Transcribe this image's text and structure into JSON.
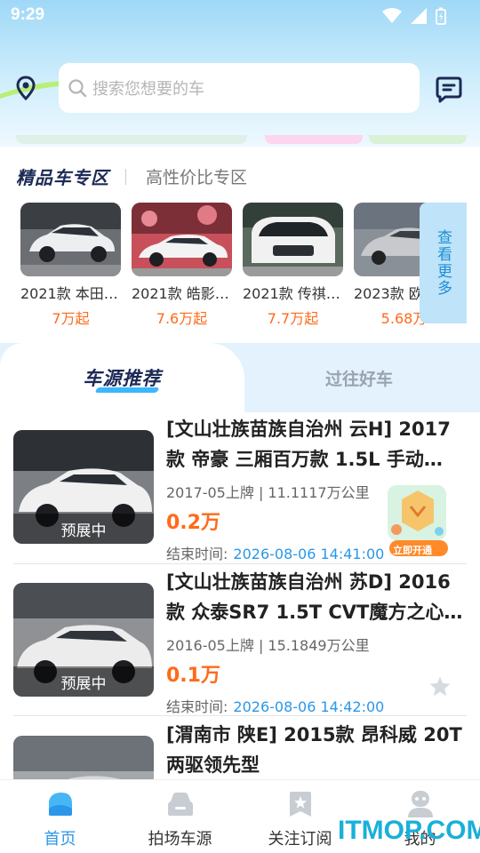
{
  "status_bar": {
    "time": "9:29"
  },
  "search": {
    "placeholder": "搜索您想要的车"
  },
  "zones": {
    "active": "精品车专区",
    "inactive": "高性价比专区"
  },
  "premium_cars": [
    {
      "name": "2021款 本田…",
      "price": "7万起"
    },
    {
      "name": "2021款 皓影…",
      "price": "7.6万起"
    },
    {
      "name": "2021款 传祺…",
      "price": "7.7万起"
    },
    {
      "name": "2023款 欧…",
      "price": "5.68万"
    }
  ],
  "see_more": "查看更多",
  "rec_tabs": {
    "active": "车源推荐",
    "inactive": "过往好车"
  },
  "listings": [
    {
      "title": "[文山壮族苗族自治州 云H] 2017款 帝豪 三厢百万款 1.5L 手动…",
      "meta": "2017-05上牌 | 11.1117万公里",
      "price": "0.2万",
      "status": "预展中",
      "end_label": "结束时间:",
      "end_time": "2026-08-06 14:41:00"
    },
    {
      "title": "[文山壮族苗族自治州 苏D] 2016款 众泰SR7 1.5T CVT魔方之心…",
      "meta": "2016-05上牌 | 15.1849万公里",
      "price": "0.1万",
      "status": "预展中",
      "end_label": "结束时间:",
      "end_time": "2026-08-06 14:42:00"
    },
    {
      "title": "[渭南市 陕E] 2015款 昂科威 20T 两驱领先型"
    }
  ],
  "promo": {
    "cta": "立即开通"
  },
  "bottom_nav": [
    {
      "label": "首页"
    },
    {
      "label": "拍场车源"
    },
    {
      "label": "关注订阅"
    },
    {
      "label": "我的"
    }
  ],
  "watermark": "ITMOP.COM",
  "colors": {
    "accent": "#2a97e8",
    "price": "#ff6a1a",
    "brand_dark": "#1d2a55"
  }
}
